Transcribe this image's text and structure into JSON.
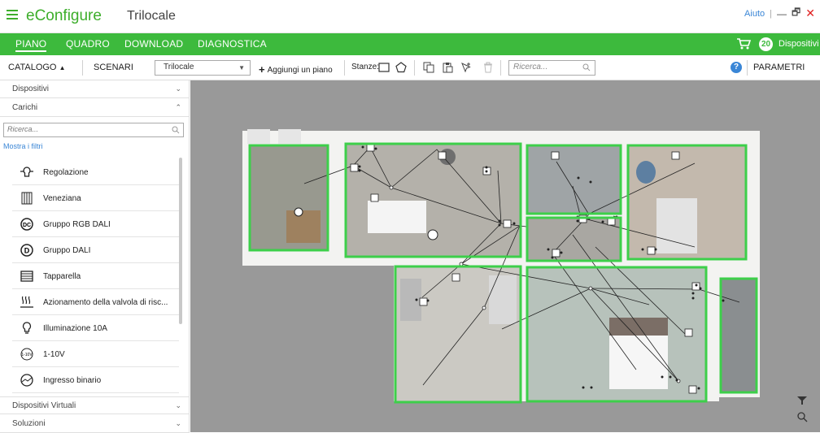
{
  "app": {
    "name": "eConfigure",
    "project": "Trilocale"
  },
  "window": {
    "help": "Aiuto",
    "separator": "|",
    "minimize": "—",
    "restore": "🗗",
    "close": "✕"
  },
  "nav": {
    "tabs": [
      "PIANO",
      "QUADRO",
      "DOWNLOAD",
      "DIAGNOSTICA"
    ],
    "device_count": "20",
    "devices_label": "Dispositivi"
  },
  "toolbar": {
    "catalog": "CATALOGO",
    "scenes": "SCENARI",
    "plan_selected": "Trilocale",
    "add_floor": "Aggiungi un piano",
    "rooms": "Stanze:",
    "search_placeholder": "Ricerca...",
    "params": "PARAMETRI"
  },
  "sidebar": {
    "sections": {
      "devices": "Dispositivi",
      "loads": "Carichi",
      "virtual": "Dispositivi Virtuali",
      "solutions": "Soluzioni"
    },
    "search_placeholder": "Ricerca...",
    "show_filters": "Mostra i filtri",
    "items": [
      {
        "label": "Regolazione",
        "icon": "dimmer-icon"
      },
      {
        "label": "Veneziana",
        "icon": "venetian-blind-icon"
      },
      {
        "label": "Gruppo RGB DALI",
        "icon": "rgb-dali-icon"
      },
      {
        "label": "Gruppo DALI",
        "icon": "dali-icon"
      },
      {
        "label": "Tapparella",
        "icon": "shutter-icon"
      },
      {
        "label": "Azionamento della valvola di risc...",
        "icon": "heating-valve-icon"
      },
      {
        "label": "Illuminazione 10A",
        "icon": "light-bulb-icon"
      },
      {
        "label": "1-10V",
        "icon": "1-10v-icon"
      },
      {
        "label": "Ingresso binario",
        "icon": "binary-input-icon"
      }
    ]
  },
  "colors": {
    "accent": "#3dba3d",
    "link": "#3a86d6",
    "close": "#e01f1f"
  }
}
